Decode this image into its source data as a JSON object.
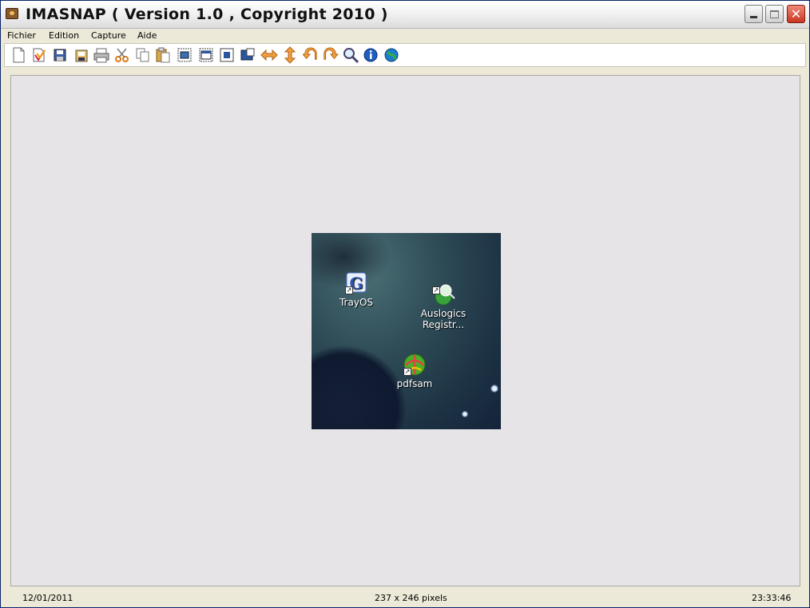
{
  "window": {
    "title": "IMASNAP ( Version 1.0 , Copyright 2010 )"
  },
  "menu": {
    "items": [
      "Fichier",
      "Edition",
      "Capture",
      "Aide"
    ]
  },
  "toolbar": {
    "buttons": [
      "new-doc-icon",
      "open-icon",
      "save-icon",
      "save-as-icon",
      "print-icon",
      "cut-icon",
      "copy-icon",
      "paste-icon",
      "capture-screen-icon",
      "capture-window-icon",
      "capture-area-icon",
      "capture-object-icon",
      "flip-horizontal-icon",
      "flip-vertical-icon",
      "rotate-left-icon",
      "rotate-right-icon",
      "zoom-icon",
      "info-icon",
      "web-icon"
    ]
  },
  "snapshot": {
    "icons": [
      {
        "label": "TrayOS"
      },
      {
        "label": "Auslogics\nRegistr..."
      },
      {
        "label": "pdfsam"
      }
    ]
  },
  "status": {
    "date": "12/01/2011",
    "size": "237 x 246 pixels",
    "time": "23:33:46"
  }
}
